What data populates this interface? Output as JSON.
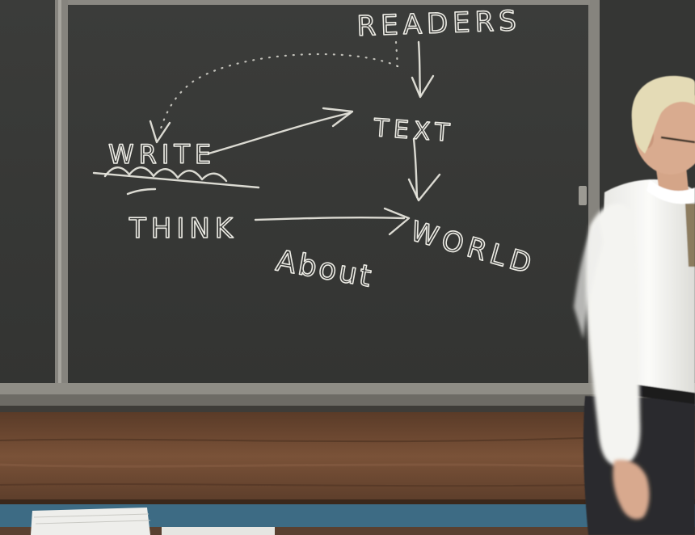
{
  "scene": {
    "description_free": true
  },
  "board": {
    "words": {
      "readers": "READERS",
      "text": "TEXT",
      "write": "WRITE",
      "think": "THINK",
      "about": "About",
      "world": "WORLD"
    }
  },
  "colors": {
    "chalkboard": "#3a3b39",
    "frame": "#7a7872",
    "chalk": "#ecebe4",
    "wood_rail": "#6b4a34",
    "wall_blue": "#3f6f87",
    "shirt": "#f3f3f0",
    "trousers": "#2b2b2d",
    "hair": "#e3d9b4",
    "skin": "#d9ab8f"
  }
}
